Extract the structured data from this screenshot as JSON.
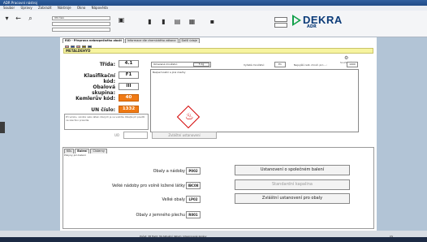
{
  "window": {
    "title": "ADR Pracovní nástroj"
  },
  "menu": [
    "Soubor",
    "Úpravy",
    "Zobrazit",
    "Nástroje",
    "Okno",
    "Nápověda"
  ],
  "toolbar": {
    "field1": "UN číslo",
    "brand": "DEKRA",
    "brand_sub": "ADR"
  },
  "tabs": [
    "RID - Přeprava nebezpečného zboží",
    "Informace dle chemického zákona",
    "Další údaje"
  ],
  "substance": {
    "name": "METALDEHYD"
  },
  "summary_label": "Souhrnný",
  "fields": [
    {
      "label": "Třída:",
      "value": "4.1"
    },
    {
      "label": "Klasifikační kód:",
      "value": "F1"
    },
    {
      "label": "Obalová skupina:",
      "value": "III"
    },
    {
      "label": "Kemlerův kód:",
      "value": "40"
    },
    {
      "label": "UN číslo:",
      "value": "1332"
    }
  ],
  "limits": {
    "omezene_label": "Omezené množství:",
    "omezene_value": "5 kg",
    "vynate_label": "Vyňaté množství:",
    "vynate_value": "E1",
    "max_label": "Nejvyšší celk. množ. pro ...:",
    "max_value": "1000"
  },
  "hazard": {
    "title": "Bezpečnostní a jiné značky"
  },
  "note": "Při vzniku, vzniklé nebo látek, kterých je ve vozidle. Dbejte při použití na všechno pravidla.",
  "uo": {
    "label": "UO"
  },
  "special_button": "Zvláštní ustanovení",
  "pack": {
    "tabs": [
      "Kůs",
      "Balení",
      "Cisterny"
    ],
    "subtitle": "Pokyny pro balení",
    "rows": [
      {
        "label": "Obaly a nádoby",
        "code": "P002"
      },
      {
        "label": "Velké nádoby pro volně ložené látky",
        "code": "IBC08"
      },
      {
        "label": "Velké obaly",
        "code": "LP02"
      },
      {
        "label": "Obaly z jemného plechu",
        "code": "R001"
      }
    ],
    "buttons": [
      {
        "label": "Ustanovení o společném balení",
        "disabled": false
      },
      {
        "label": "Standardní kapalina",
        "disabled": true
      },
      {
        "label": "Zvláštní ustanovení pro obaly",
        "disabled": false
      }
    ]
  },
  "status": {
    "text": "Počet: 38  Hald: 39  Aktuální datum: Integrované zprávy",
    "right": "CS"
  },
  "colors": {
    "orange": "#f07a14",
    "substance_bar": "#f7f4a0",
    "brand": "#0b3b78",
    "brand_arrow": "#12a04a"
  }
}
